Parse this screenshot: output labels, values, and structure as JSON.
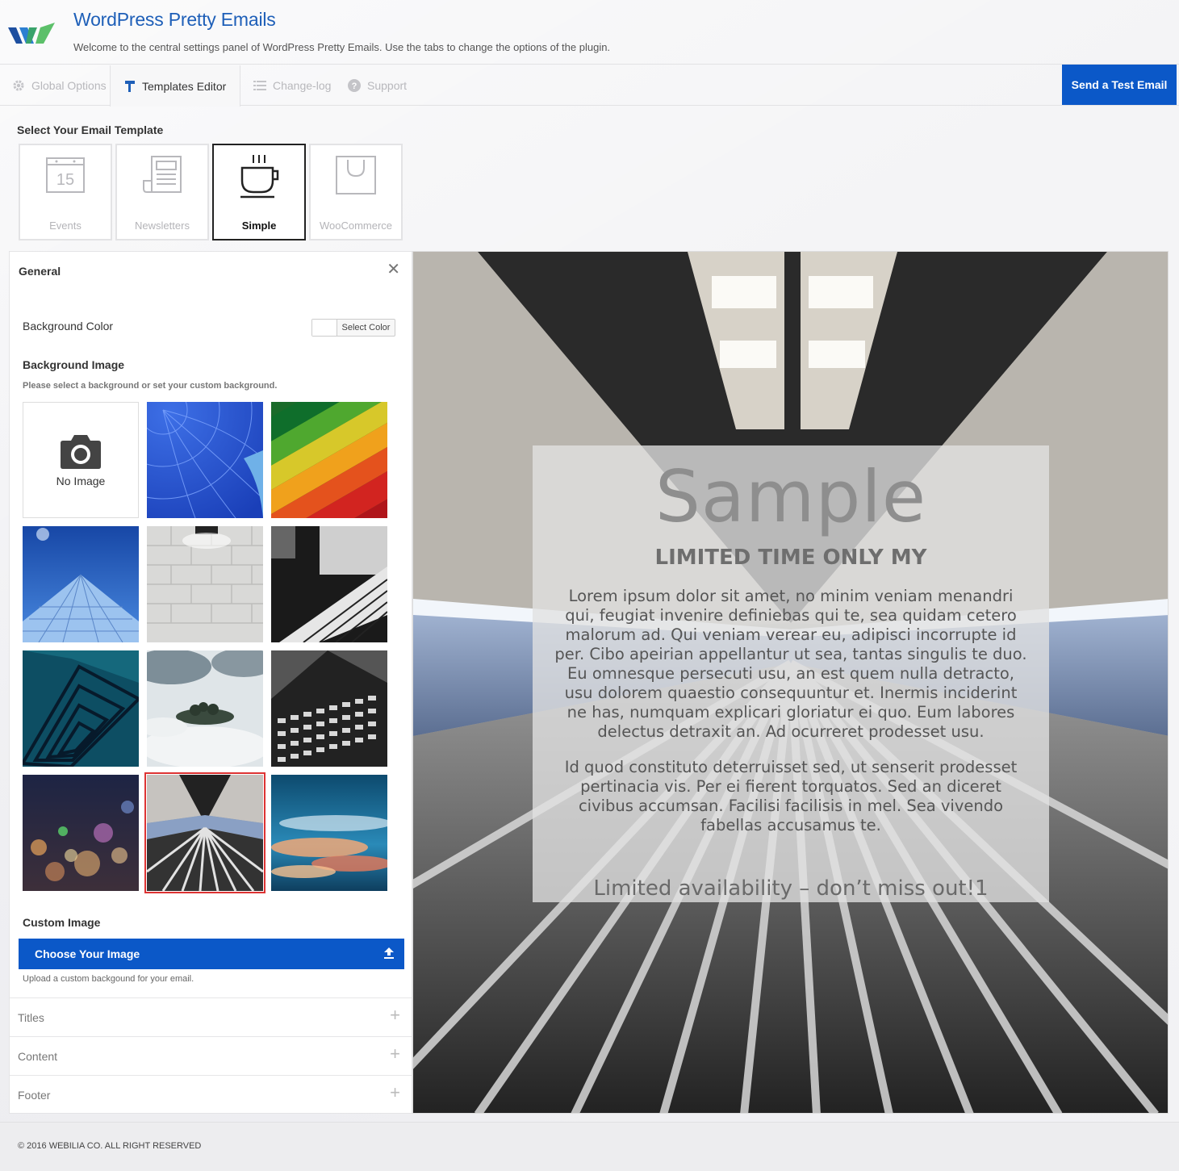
{
  "header": {
    "title": "WordPress Pretty Emails",
    "subtitle": "Welcome to the central settings panel of WordPress Pretty Emails. Use the tabs to change the options of the plugin."
  },
  "tabs": [
    {
      "label": "Global Options",
      "icon": "gear-icon"
    },
    {
      "label": "Templates Editor",
      "icon": "paint-roller-icon",
      "active": true
    },
    {
      "label": "Change-log",
      "icon": "list-icon"
    },
    {
      "label": "Support",
      "icon": "question-icon"
    }
  ],
  "send_test_label": "Send a Test Email",
  "templates": {
    "heading": "Select Your Email Template",
    "items": [
      {
        "label": "Events",
        "icon": "calendar-icon",
        "calendar_day": "15"
      },
      {
        "label": "Newsletters",
        "icon": "newspaper-icon"
      },
      {
        "label": "Simple",
        "icon": "coffee-cup-icon",
        "active": true
      },
      {
        "label": "WooCommerce",
        "icon": "shopping-bag-icon"
      }
    ]
  },
  "panel": {
    "heading": "General",
    "background_color_label": "Background Color",
    "select_color_label": "Select Color",
    "background_image_title": "Background Image",
    "background_image_help": "Please select a background or set your custom background.",
    "no_image_label": "No Image",
    "images": [
      "hot-air-balloon",
      "colored-pencils",
      "skyscraper",
      "white-brick-wall",
      "piano-keys",
      "spiral-staircase",
      "foggy-island",
      "dark-building",
      "city-bokeh",
      "subway-tunnel",
      "sunset-clouds"
    ],
    "selected_image": "subway-tunnel",
    "custom_image_title": "Custom Image",
    "choose_image_label": "Choose Your Image",
    "custom_image_help": "Upload a custom backgound for your email.",
    "sections": [
      "Titles",
      "Content",
      "Footer"
    ]
  },
  "preview": {
    "title": "Sample",
    "subtitle": "LIMITED TIME ONLY MY",
    "paragraph1": "Lorem ipsum dolor sit amet, no minim veniam menandri qui, feugiat invenire definiebas qui te, sea quidam cetero malorum ad. Qui veniam verear eu, adipisci incorrupte id per. Cibo apeirian appellantur ut sea, tantas singulis te duo. Eu omnesque persecuti usu, an est quem nulla detracto, usu dolorem quaestio consequuntur et. Inermis inciderint ne has, numquam explicari gloriatur ei quo. Eum labores delectus detraxit an. Ad ocurreret prodesset usu.",
    "paragraph2": "Id quod constituto deterruisset sed, ut senserit prodesset pertinacia vis. Per ei fierent torquatos. Sed an diceret civibus accumsan. Facilisi facilisis in mel. Sea vivendo fabellas accusamus te.",
    "footer_text": "Limited availability – don’t miss out!1"
  },
  "footer": {
    "copyright": "© 2016 WEBILIA CO. ALL RIGHT RESERVED"
  },
  "colors": {
    "accent": "#0b58c8",
    "title_blue": "#1e5fb8",
    "selected_border": "#dd3333"
  }
}
